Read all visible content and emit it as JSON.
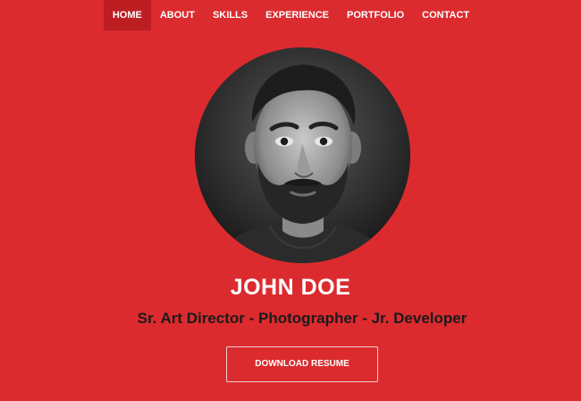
{
  "nav": {
    "items": [
      {
        "label": "HOME",
        "active": true
      },
      {
        "label": "ABOUT"
      },
      {
        "label": "SKILLS"
      },
      {
        "label": "EXPERIENCE"
      },
      {
        "label": "PORTFOLIO"
      },
      {
        "label": "CONTACT"
      }
    ]
  },
  "profile": {
    "name": "JOHN DOE",
    "subtitle": "Sr. Art Director - Photographer - Jr. Developer",
    "photo_icon": "profile-photo"
  },
  "actions": {
    "download_label": "DOWNLOAD RESUME"
  },
  "colors": {
    "background": "#db2b2f",
    "nav_active": "#bc1e22",
    "text_light": "#ffffff",
    "text_dark": "#1c1a1a"
  }
}
